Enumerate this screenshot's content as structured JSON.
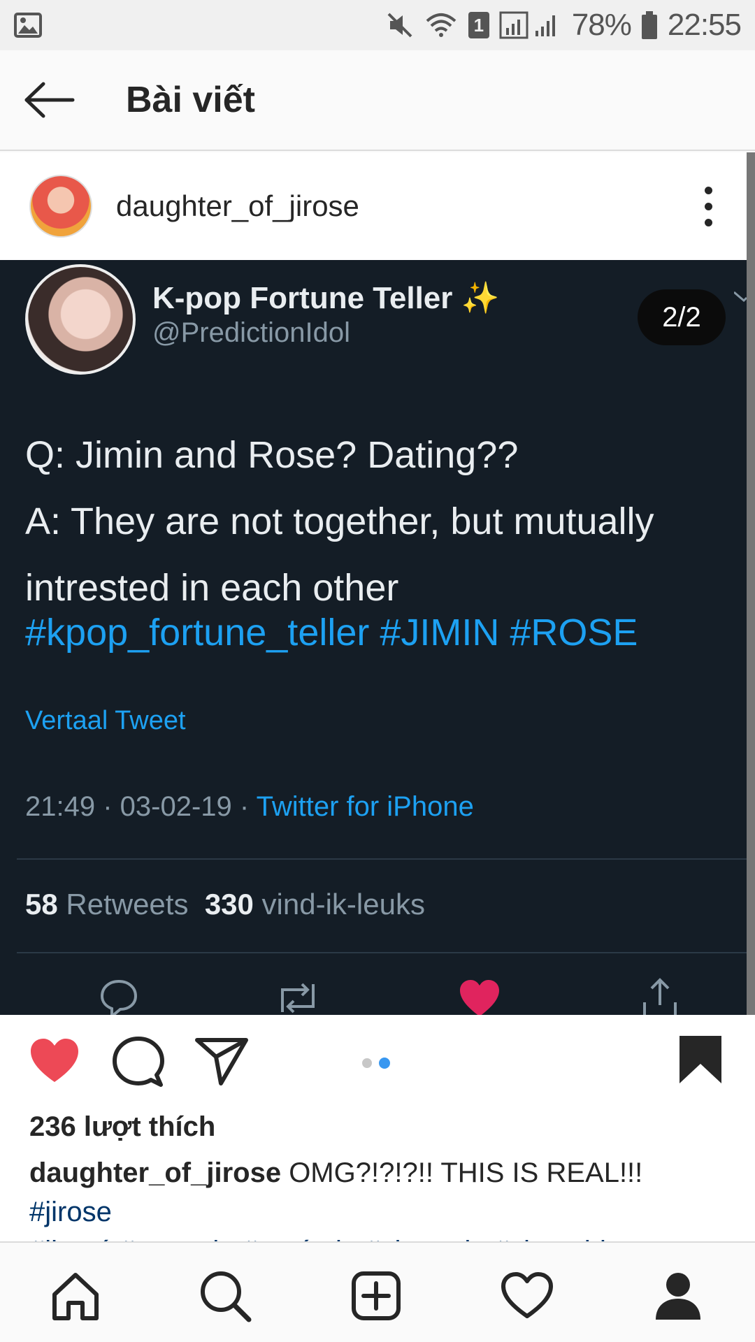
{
  "status_bar": {
    "battery": "78%",
    "time": "22:55",
    "sim_slot": "1",
    "icons": [
      "image-icon",
      "mute-icon",
      "wifi-icon",
      "sim-icon",
      "signal-icon",
      "battery-icon"
    ]
  },
  "top_bar": {
    "title": "Bài viết",
    "back_icon": "arrow-left-icon"
  },
  "post": {
    "username": "daughter_of_jirose",
    "menu_icon": "more-vertical-icon",
    "tweet": {
      "display_name": "K-pop Fortune Teller ✨",
      "handle": "@PredictionIdol",
      "page_counter": "2/2",
      "line1": "Q: Jimin and Rose? Dating??",
      "line2": "A: They are not together, but mutually",
      "line3": "intrested in each other",
      "hashtags": "#kpop_fortune_teller #JIMIN #ROSE",
      "translate": "Vertaal Tweet",
      "timestamp": "21:49 · 03-02-19 · ",
      "source": "Twitter for iPhone",
      "retweets_count": "58",
      "retweets_label": " Retweets  ",
      "likes_count": "330",
      "likes_label": " vind-ik-leuks"
    },
    "likes": "236 lượt thích",
    "caption": {
      "user": "daughter_of_jirose",
      "text": " OMG?!?!?!! THIS IS REAL!!! ",
      "tag1": "#jirose",
      "tags_line2": "#jirosé #rosemin #rosémin #chaemin #chaechim"
    },
    "carousel": {
      "total": 2,
      "active": 2
    },
    "colors": {
      "like": "#ed4956",
      "link": "#003569",
      "tweet_bg": "#141d26",
      "tweet_link": "#1da1f2"
    }
  },
  "bottom_nav": {
    "items": [
      "home-icon",
      "search-icon",
      "add-post-icon",
      "activity-icon",
      "profile-icon"
    ]
  }
}
